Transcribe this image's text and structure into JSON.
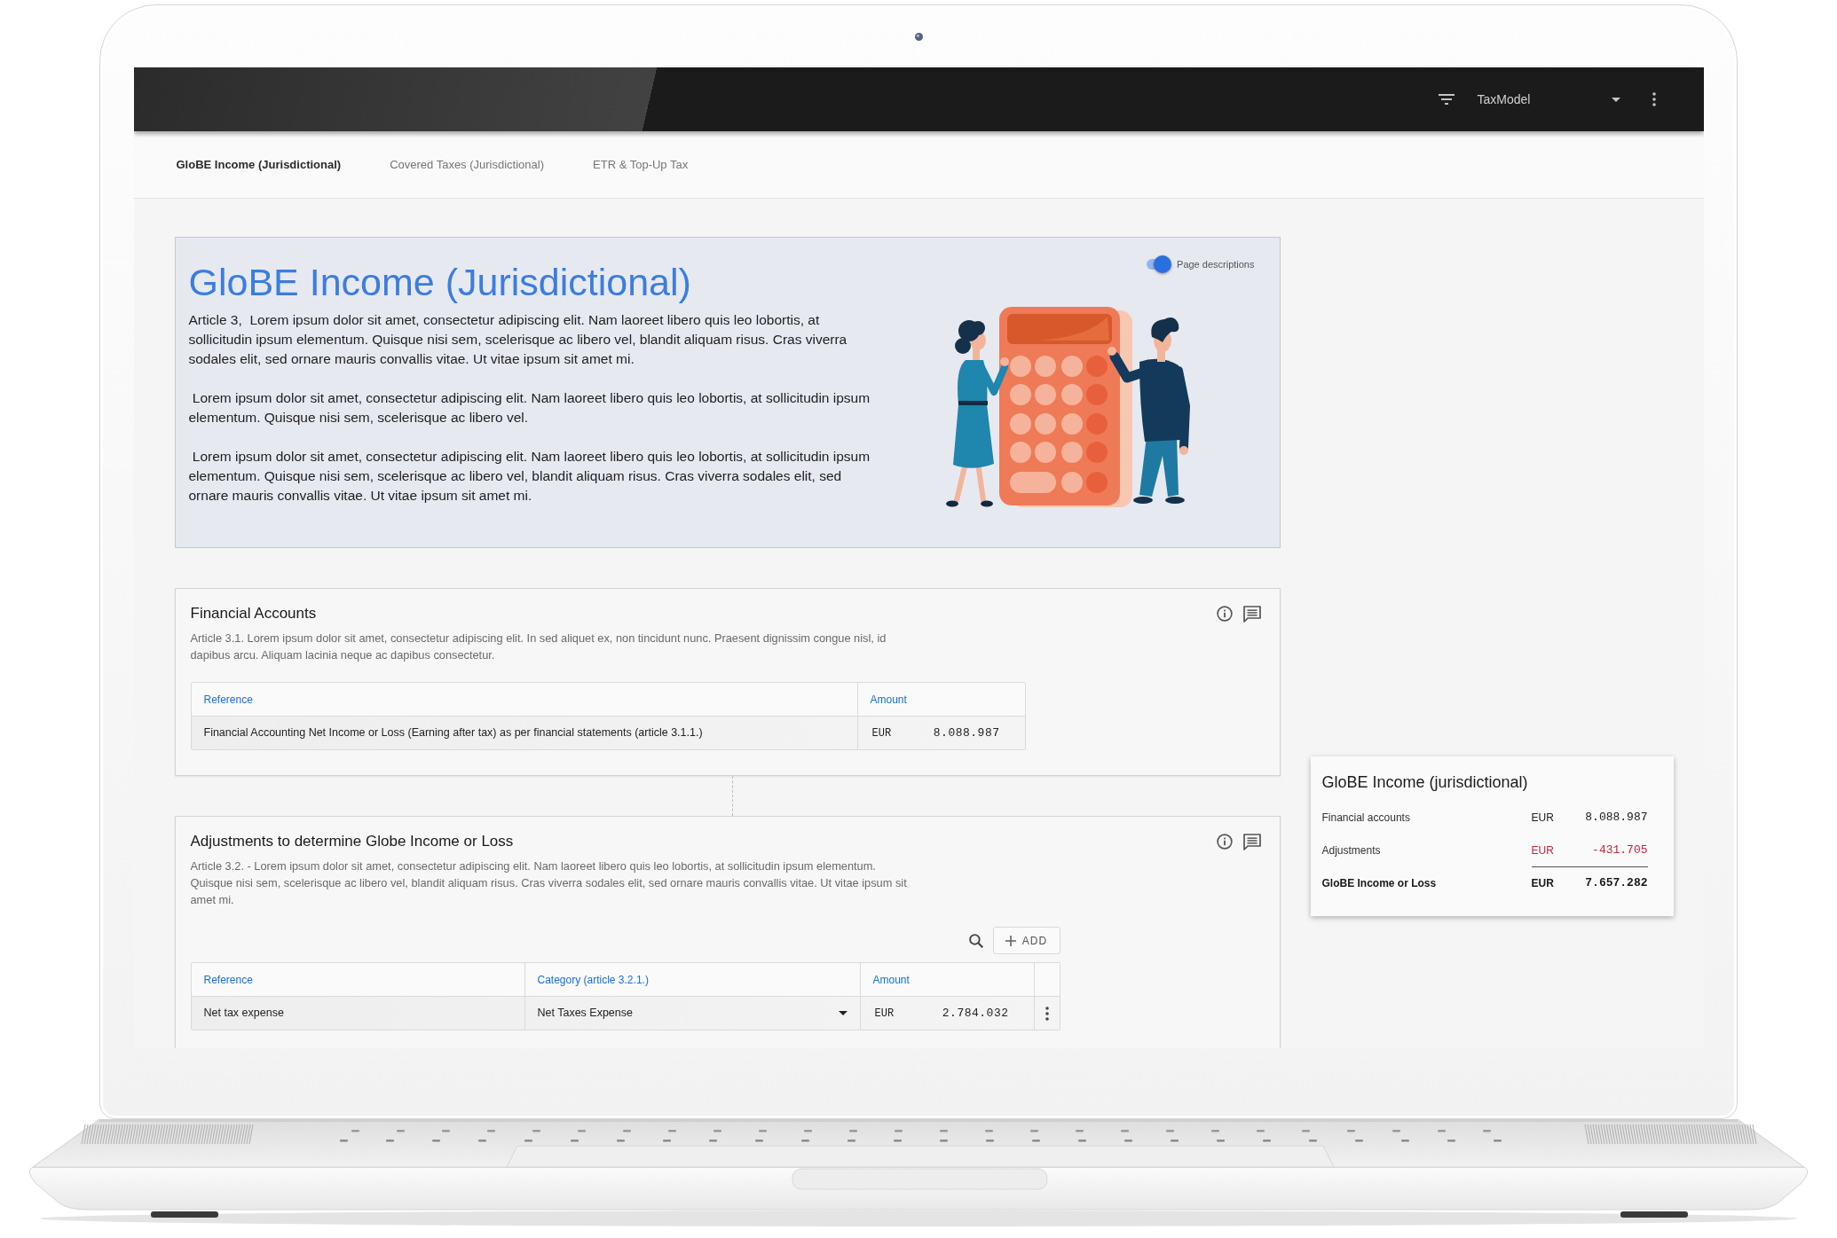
{
  "app_bar": {
    "model_select": {
      "value": "TaxModel"
    }
  },
  "tabs": [
    {
      "label": "GloBE Income (Jurisdictional)",
      "selected": true
    },
    {
      "label": "Covered Taxes (Jurisdictional)",
      "selected": false
    },
    {
      "label": "ETR & Top-Up Tax",
      "selected": false
    }
  ],
  "hero": {
    "title": "GloBE Income (Jurisdictional)",
    "toggle": {
      "label": "Page descriptions",
      "on": true
    },
    "paragraphs": [
      "Article 3,  Lorem ipsum dolor sit amet, consectetur adipiscing elit. Nam laoreet libero quis leo lobortis, at sollicitudin ipsum elementum. Quisque nisi sem, scelerisque ac libero vel, blandit aliquam risus. Cras viverra sodales elit, sed ornare mauris convallis vitae. Ut vitae ipsum sit amet mi.",
      " Lorem ipsum dolor sit amet, consectetur adipiscing elit. Nam laoreet libero quis leo lobortis, at sollicitudin ipsum elementum. Quisque nisi sem, scelerisque ac libero vel.",
      " Lorem ipsum dolor sit amet, consectetur adipiscing elit. Nam laoreet libero quis leo lobortis, at sollicitudin ipsum elementum. Quisque nisi sem, scelerisque ac libero vel, blandit aliquam risus. Cras viverra sodales elit, sed ornare mauris convallis vitae. Ut vitae ipsum sit amet mi."
    ]
  },
  "sections": [
    {
      "kind": "readonly",
      "title": "Financial Accounts",
      "description": "Article 3.1. Lorem ipsum dolor sit amet, consectetur adipiscing elit. In sed aliquet ex, non tincidunt nunc. Praesent dignissim congue nisl, id dapibus arcu. Aliquam lacinia neque ac dapibus consectetur.",
      "table": {
        "columns": [
          "Reference",
          "Amount"
        ],
        "rows": [
          {
            "reference": "Financial Accounting Net Income or Loss (Earning after tax) as per financial statements (article 3.1.1.)",
            "currency": "EUR",
            "amount": "8.088.987"
          }
        ]
      }
    },
    {
      "kind": "editable",
      "title": "Adjustments to determine Globe Income or Loss",
      "description": "Article 3.2. - Lorem ipsum dolor sit amet, consectetur adipiscing elit. Nam laoreet libero quis leo lobortis, at sollicitudin ipsum elementum. Quisque nisi sem, scelerisque ac libero vel, blandit aliquam risus. Cras viverra sodales elit, sed ornare mauris convallis vitae. Ut vitae ipsum sit amet mi.",
      "add_button": "ADD",
      "table": {
        "columns": [
          "Reference",
          "Category (article 3.2.1.)",
          "Amount"
        ],
        "rows": [
          {
            "reference": "Net tax expense",
            "category": "Net Taxes Expense",
            "currency": "EUR",
            "amount": "2.784.032"
          }
        ]
      }
    }
  ],
  "summary": {
    "title": "GloBE Income (jurisdictional)",
    "rows": [
      {
        "label": "Financial accounts",
        "currency": "EUR",
        "amount": "8.088.987",
        "kind": "item",
        "negative": false
      },
      {
        "label": "Adjustments",
        "currency": "EUR",
        "amount": "-431.705",
        "kind": "item",
        "negative": true
      },
      {
        "label": "GloBE Income or Loss",
        "currency": "EUR",
        "amount": "7.657.282",
        "kind": "total",
        "negative": false
      }
    ]
  }
}
